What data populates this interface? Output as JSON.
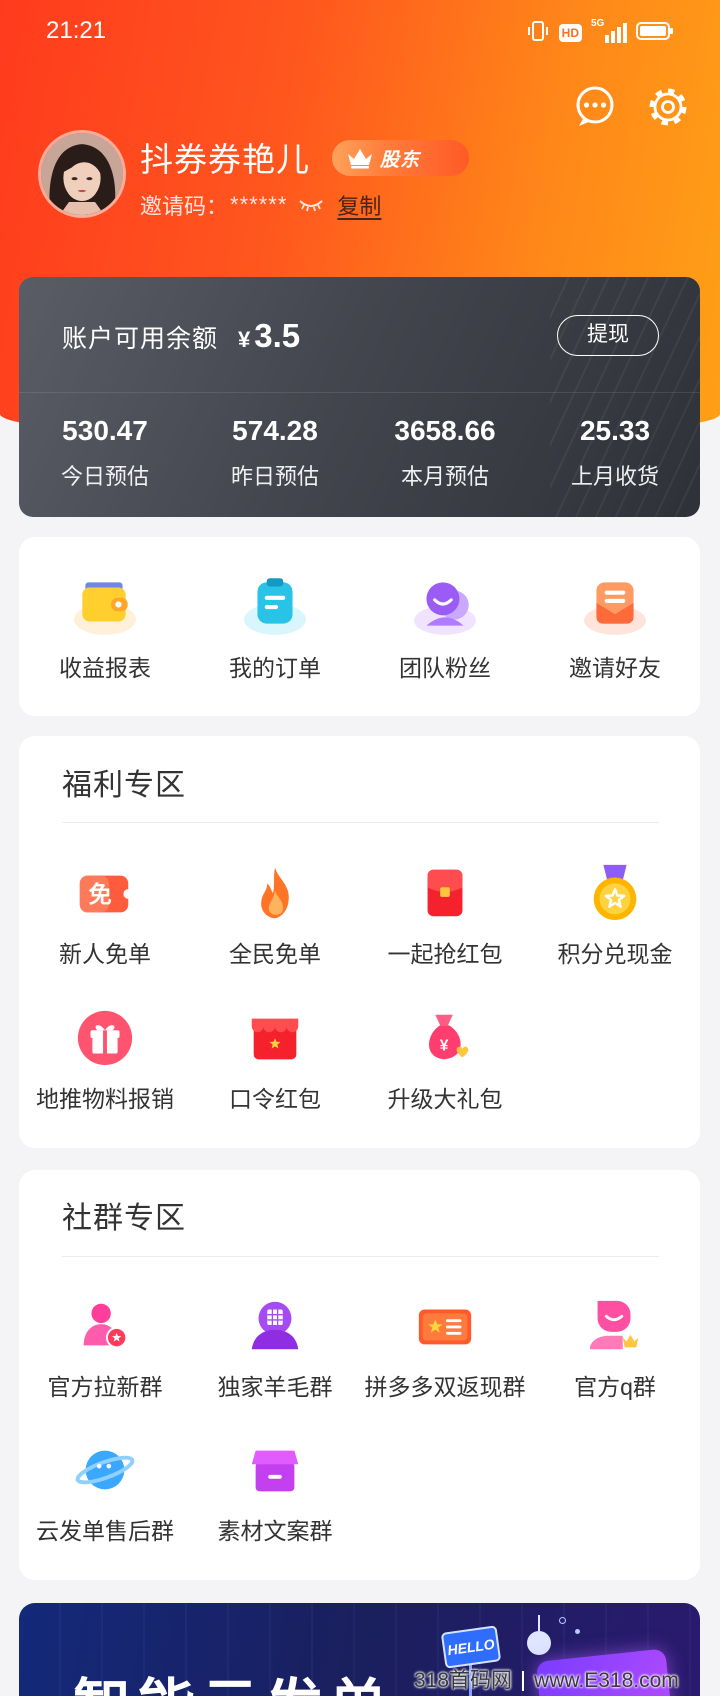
{
  "colors": {
    "header_start": "#ff3b1d",
    "header_end": "#ffa016",
    "account_card": "#3a3c45",
    "page_background": "#f4f4f6"
  },
  "status_bar": {
    "time": "21:21",
    "hd_label": "HD",
    "network_label": "5G",
    "icons": [
      "vibrate-icon",
      "hd-icon",
      "signal-icon",
      "battery-icon"
    ]
  },
  "header": {
    "chat_icon": "chat-bubble-icon",
    "settings_icon": "gear-icon"
  },
  "profile": {
    "name": "抖券券艳儿",
    "badge_label": "股东",
    "badge_icon": "crown-icon",
    "invite_label": "邀请码：",
    "invite_code": "******",
    "visibility_icon": "eye-closed-icon",
    "copy_label": "复制"
  },
  "account": {
    "balance_label": "账户可用余额",
    "currency": "¥",
    "balance": "3.5",
    "withdraw_label": "提现",
    "stats": [
      {
        "value": "530.47",
        "label": "今日预估"
      },
      {
        "value": "574.28",
        "label": "昨日预估"
      },
      {
        "value": "3658.66",
        "label": "本月预估"
      },
      {
        "value": "25.33",
        "label": "上月收货"
      }
    ]
  },
  "quick_actions": [
    {
      "label": "收益报表",
      "icon": "wallet-icon"
    },
    {
      "label": "我的订单",
      "icon": "clipboard-icon"
    },
    {
      "label": "团队粉丝",
      "icon": "team-icon"
    },
    {
      "label": "邀请好友",
      "icon": "invite-envelope-icon"
    }
  ],
  "welfare": {
    "title": "福利专区",
    "items": [
      {
        "label": "新人免单",
        "icon": "free-ticket-icon",
        "icon_text": "免"
      },
      {
        "label": "全民免单",
        "icon": "flame-icon"
      },
      {
        "label": "一起抢红包",
        "icon": "red-envelope-icon"
      },
      {
        "label": "积分兑现金",
        "icon": "medal-icon"
      },
      {
        "label": "地推物料报销",
        "icon": "gift-icon"
      },
      {
        "label": "口令红包",
        "icon": "red-packet-box-icon"
      },
      {
        "label": "升级大礼包",
        "icon": "money-bag-icon",
        "icon_text": "¥"
      }
    ]
  },
  "community": {
    "title": "社群专区",
    "items": [
      {
        "label": "官方拉新群",
        "icon": "user-star-icon"
      },
      {
        "label": "独家羊毛群",
        "icon": "avatar-grid-icon"
      },
      {
        "label": "拼多多双返现群",
        "icon": "ticket-star-icon"
      },
      {
        "label": "官方q群",
        "icon": "bubble-crown-icon"
      },
      {
        "label": "云发单售后群",
        "icon": "planet-icon"
      },
      {
        "label": "素材文案群",
        "icon": "store-box-icon"
      }
    ]
  },
  "banner": {
    "headline": "智能云发单",
    "sign_text": "HELLO"
  },
  "watermark": {
    "site_name": "318首码网",
    "url": "www.E318.com"
  }
}
